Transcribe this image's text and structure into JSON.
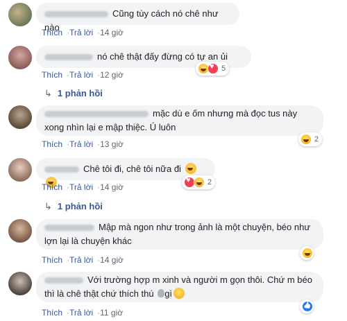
{
  "actions": {
    "like": "Thích",
    "reply": "Trả lời"
  },
  "comments": [
    {
      "text": "Cũng tùy cách nó chê như nào",
      "time": "14 giờ"
    },
    {
      "text": "nó chê thật đấy đừng có tự an ủi",
      "time": "12 giờ",
      "reaction_count": "5",
      "reaction_icons": [
        "haha",
        "love"
      ],
      "replies": "1 phản hồi"
    },
    {
      "text_line1": "mặc dù e ốm nhưng mà đọc tus này",
      "text_line2": "xong nhìn lại e mập thiệc. Ú luôn",
      "time": "13 giờ",
      "reaction_count": "2",
      "reaction_icons": [
        "haha"
      ]
    },
    {
      "text": "Chê tôi đi, chê tôi nữa đi",
      "time": "14 giờ",
      "reaction_count": "2",
      "reaction_icons": [
        "love",
        "haha"
      ],
      "inline_emoji": [
        "haha",
        "haha"
      ],
      "replies": "1 phản hồi"
    },
    {
      "text_line1": "Mập mà ngon như trong ảnh là một chuyện, béo như",
      "text_line2": "lợn lại là chuyện khác",
      "time": "14 giờ",
      "reaction_icons": [
        "haha"
      ]
    },
    {
      "text_line1": "Với trường hợp m xinh và người m gọn thôi. Chứ m béo",
      "text_line2": "thì là chê thật chứ thích thú",
      "text_tail": "gì",
      "time": "11 giờ",
      "reaction_icons": [
        "like"
      ]
    }
  ],
  "colors": {
    "link": "#385898",
    "bubble": "#f2f3f5",
    "meta": "#606770"
  }
}
